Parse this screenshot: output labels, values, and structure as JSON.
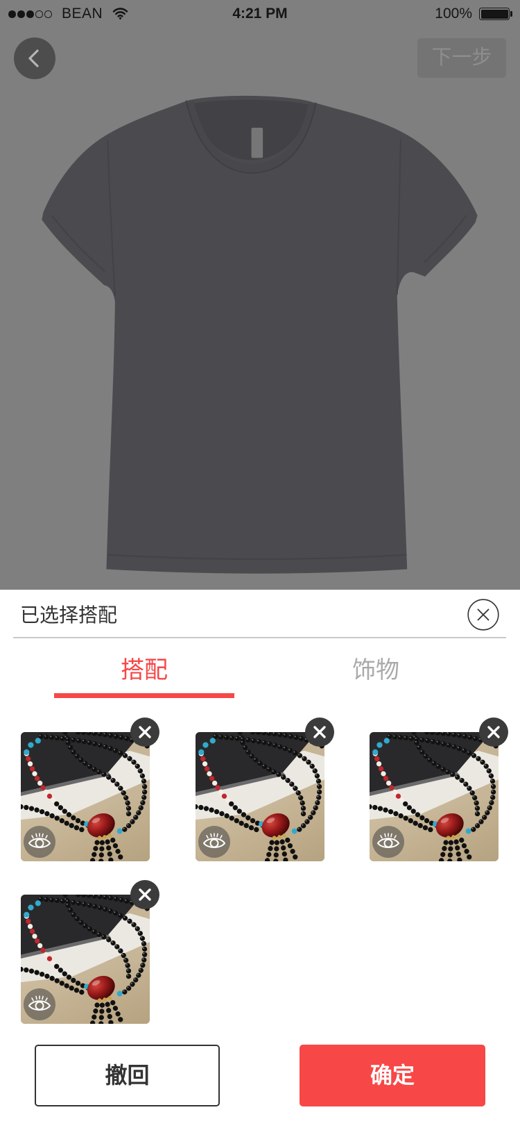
{
  "status_bar": {
    "signal_level": 3,
    "signal_max": 5,
    "carrier": "BEAN",
    "wifi_icon": "wifi-icon",
    "time": "4:21 PM",
    "battery_text": "100%",
    "battery_level": 100,
    "battery_icon": "battery-icon"
  },
  "nav": {
    "back_icon": "chevron-left-icon",
    "next_label": "下一步"
  },
  "sheet": {
    "title": "已选择搭配",
    "close_icon": "close-circle-icon",
    "tabs": [
      {
        "label": "搭配",
        "active": true
      },
      {
        "label": "饰物",
        "active": false
      }
    ],
    "items": [
      {
        "remove_icon": "close-icon",
        "preview_icon": "eye-icon"
      },
      {
        "remove_icon": "close-icon",
        "preview_icon": "eye-icon"
      },
      {
        "remove_icon": "close-icon",
        "preview_icon": "eye-icon"
      },
      {
        "remove_icon": "close-icon",
        "preview_icon": "eye-icon"
      }
    ],
    "buttons": {
      "undo_label": "撤回",
      "confirm_label": "确定"
    }
  },
  "colors": {
    "accent": "#f74747",
    "mask": "#7f7f7f",
    "shirt": "#4b4a4f",
    "text": "#333333",
    "inactive_tab": "#aaaaaa"
  }
}
